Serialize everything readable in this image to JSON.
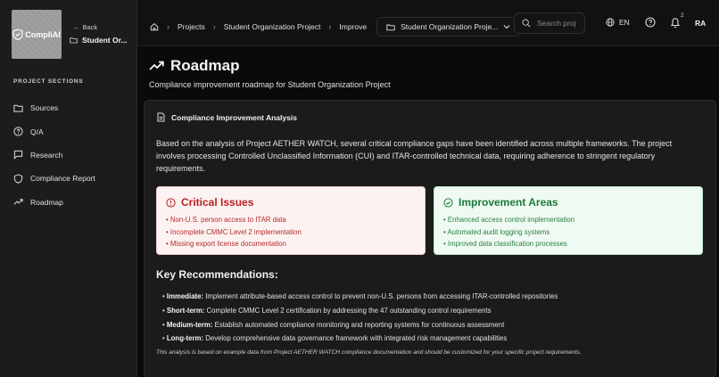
{
  "sidebar": {
    "logo_text": "CompliAI",
    "back_label": "Back",
    "project_name": "Student Or...",
    "section_heading": "PROJECT SECTIONS",
    "items": [
      {
        "label": "Sources",
        "icon": "folder-icon"
      },
      {
        "label": "Q/A",
        "icon": "question-circle-icon"
      },
      {
        "label": "Research",
        "icon": "chat-bubble-icon"
      },
      {
        "label": "Compliance Report",
        "icon": "shield-icon"
      },
      {
        "label": "Roadmap",
        "icon": "trending-up-icon"
      }
    ]
  },
  "topbar": {
    "breadcrumbs": [
      "Projects",
      "Student Organization Project",
      "Improve"
    ],
    "project_select": "Student Organization Proje...",
    "search_placeholder": "Search proj",
    "language": "EN",
    "notification_count": "2",
    "avatar_initials": "RA"
  },
  "page": {
    "title": "Roadmap",
    "subtitle": "Compliance improvement roadmap for Student Organization Project"
  },
  "card": {
    "heading": "Compliance Improvement Analysis",
    "intro": "Based on the analysis of Project AETHER WATCH, several critical compliance gaps have been identified across multiple frameworks. The project involves processing Controlled Unclassified Information (CUI) and ITAR-controlled technical data, requiring adherence to stringent regulatory requirements.",
    "critical": {
      "title": "Critical Issues",
      "items": [
        "Non-U.S. person access to ITAR data",
        "Incomplete CMMC Level 2 implementation",
        "Missing export license documentation"
      ]
    },
    "improvement": {
      "title": "Improvement Areas",
      "items": [
        "Enhanced access control implementation",
        "Automated audit logging systems",
        "Improved data classification processes"
      ]
    },
    "recommendations_title": "Key Recommendations:",
    "recommendations": [
      {
        "term": "Immediate:",
        "text": "Implement attribute-based access control to prevent non-U.S. persons from accessing ITAR-controlled repositories"
      },
      {
        "term": "Short-term:",
        "text": "Complete CMMC Level 2 certification by addressing the 47 outstanding control requirements"
      },
      {
        "term": "Medium-term:",
        "text": "Establish automated compliance monitoring and reporting systems for continuous assessment"
      },
      {
        "term": "Long-term:",
        "text": "Develop comprehensive data governance framework with integrated risk management capabilities"
      }
    ],
    "note": "This analysis is based on example data from Project AETHER WATCH compliance documentation and should be customized for your specific project requirements."
  },
  "colors": {
    "critical_text": "#b81f1f",
    "critical_bg": "#fdf2f2",
    "improve_text": "#1b7a3a",
    "improve_bg": "#effbf2"
  }
}
